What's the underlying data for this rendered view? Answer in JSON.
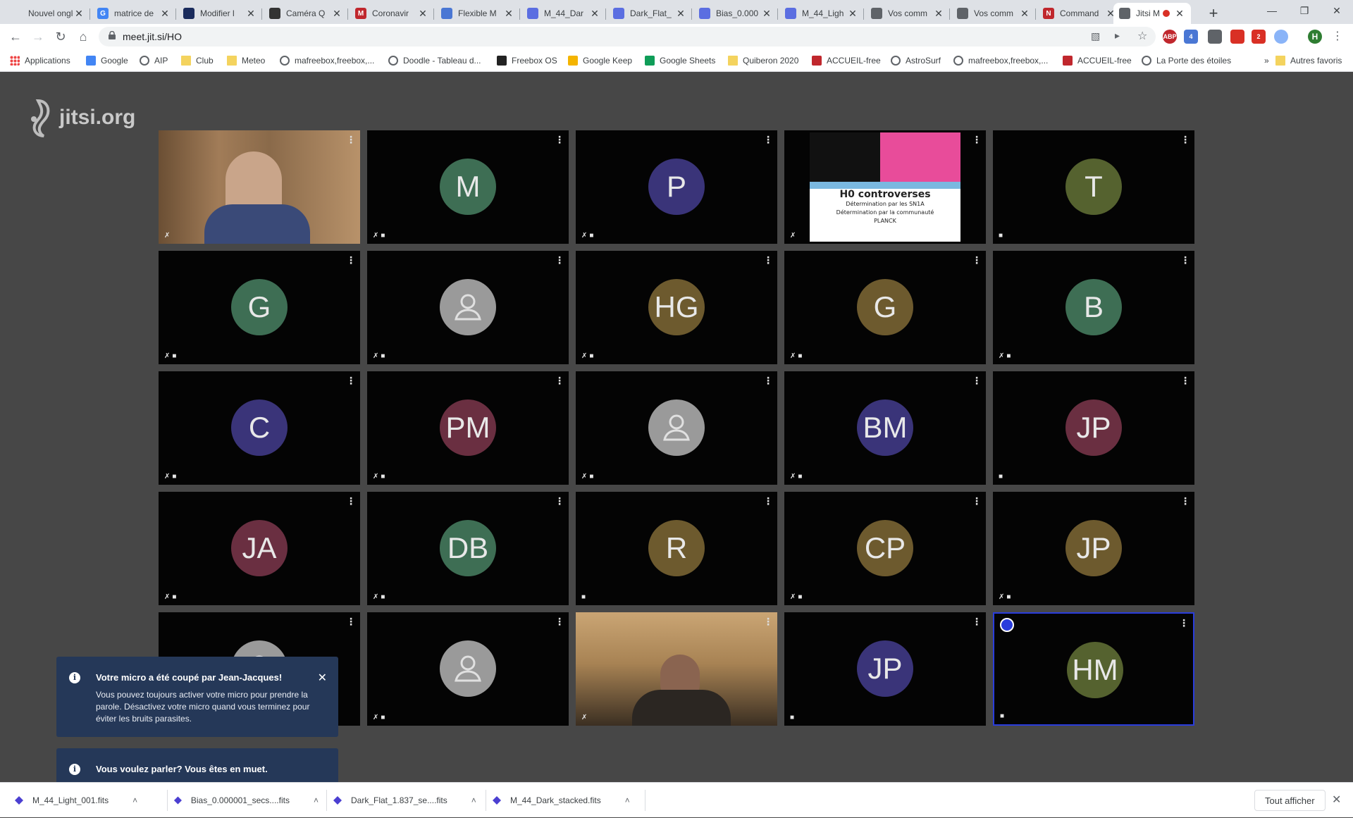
{
  "browser": {
    "tabs": [
      {
        "title": "Nouvel onglet",
        "fav": "",
        "color": "#dee1e6"
      },
      {
        "title": "matrice de",
        "fav": "G",
        "color": "#4285f4"
      },
      {
        "title": "Modifier l",
        "fav": "",
        "color": "#1a2b5c"
      },
      {
        "title": "Caméra Q",
        "fav": "",
        "color": "#333"
      },
      {
        "title": "Coronavir",
        "fav": "M",
        "color": "#c0272d"
      },
      {
        "title": "Flexible M",
        "fav": "",
        "color": "#4a77d4"
      },
      {
        "title": "M_44_Dar",
        "fav": "",
        "color": "#5b6ee1"
      },
      {
        "title": "Dark_Flat_",
        "fav": "",
        "color": "#5b6ee1"
      },
      {
        "title": "Bias_0.000",
        "fav": "",
        "color": "#5b6ee1"
      },
      {
        "title": "M_44_Ligh",
        "fav": "",
        "color": "#5b6ee1"
      },
      {
        "title": "Vos comm",
        "fav": "",
        "color": "#5f6368"
      },
      {
        "title": "Vos comm",
        "fav": "",
        "color": "#5f6368"
      },
      {
        "title": "Command",
        "fav": "N",
        "color": "#c0272d"
      },
      {
        "title": "Jitsi M",
        "fav": "",
        "color": "#5f6368"
      }
    ],
    "url": "meet.jit.si/HO",
    "profile_initial": "H",
    "ext_badges": [
      "ABP",
      "4",
      "2"
    ],
    "bookmarks": [
      {
        "label": "Applications",
        "icon": "grid"
      },
      {
        "label": "Google",
        "icon": "google"
      },
      {
        "label": "AIP",
        "icon": "globe"
      },
      {
        "label": "Club",
        "icon": "folder"
      },
      {
        "label": "Meteo",
        "icon": "folder"
      },
      {
        "label": "mafreebox,freebox,...",
        "icon": "globe"
      },
      {
        "label": "Doodle - Tableau d...",
        "icon": "globe"
      },
      {
        "label": "Freebox OS",
        "icon": "freebox"
      },
      {
        "label": "Google Keep",
        "icon": "keep"
      },
      {
        "label": "Google Sheets",
        "icon": "sheets"
      },
      {
        "label": "Quiberon 2020",
        "icon": "folder"
      },
      {
        "label": "ACCUEIL-free",
        "icon": "free"
      },
      {
        "label": "AstroSurf",
        "icon": "globe"
      },
      {
        "label": "mafreebox,freebox,...",
        "icon": "globe"
      },
      {
        "label": "ACCUEIL-free",
        "icon": "free"
      },
      {
        "label": "La Porte des étoiles",
        "icon": "globe"
      },
      {
        "label": "Autres favoris",
        "icon": "folder"
      }
    ]
  },
  "jitsi": {
    "logo_text": "jitsi.org",
    "participants": [
      {
        "initials": "",
        "color": "",
        "type": "video"
      },
      {
        "initials": "M",
        "color": "#3e6e54"
      },
      {
        "initials": "P",
        "color": "#3a3479"
      },
      {
        "initials": "",
        "color": "",
        "type": "slide"
      },
      {
        "initials": "T",
        "color": "#55622f"
      },
      {
        "initials": "G",
        "color": "#3e6e54"
      },
      {
        "initials": "",
        "color": "",
        "type": "generic"
      },
      {
        "initials": "HG",
        "color": "#6d5a2e"
      },
      {
        "initials": "G",
        "color": "#6d5a2e"
      },
      {
        "initials": "B",
        "color": "#3e6e54"
      },
      {
        "initials": "C",
        "color": "#3a3479"
      },
      {
        "initials": "PM",
        "color": "#6a2f41"
      },
      {
        "initials": "",
        "color": "",
        "type": "generic"
      },
      {
        "initials": "BM",
        "color": "#3a3479"
      },
      {
        "initials": "JP",
        "color": "#6a2f41"
      },
      {
        "initials": "JA",
        "color": "#6a2f41"
      },
      {
        "initials": "DB",
        "color": "#3e6e54"
      },
      {
        "initials": "R",
        "color": "#6d5a2e"
      },
      {
        "initials": "CP",
        "color": "#6d5a2e"
      },
      {
        "initials": "JP",
        "color": "#6d5a2e"
      },
      {
        "initials": "",
        "color": "",
        "type": "generic"
      },
      {
        "initials": "",
        "color": "",
        "type": "generic"
      },
      {
        "initials": "",
        "color": "",
        "type": "video2"
      },
      {
        "initials": "JP",
        "color": "#3a3479"
      },
      {
        "initials": "HM",
        "color": "#55622f"
      }
    ],
    "slide": {
      "title": "H0 controverses",
      "line1": "Détermination par les SN1A",
      "line2": "Détermination par la communauté",
      "line3": "PLANCK"
    },
    "notifications": [
      {
        "title": "Votre micro a été coupé par Jean-Jacques!",
        "body": "Vous pouvez toujours activer votre micro pour prendre la parole. Désactivez votre micro quand vous terminez pour éviter les bruits parasites."
      },
      {
        "title": "Vous voulez parler? Vous êtes en muet."
      }
    ]
  },
  "downloads": {
    "items": [
      "M_44_Light_001.fits",
      "Bias_0.000001_secs....fits",
      "Dark_Flat_1.837_se....fits",
      "M_44_Dark_stacked.fits"
    ],
    "show_all": "Tout afficher"
  }
}
